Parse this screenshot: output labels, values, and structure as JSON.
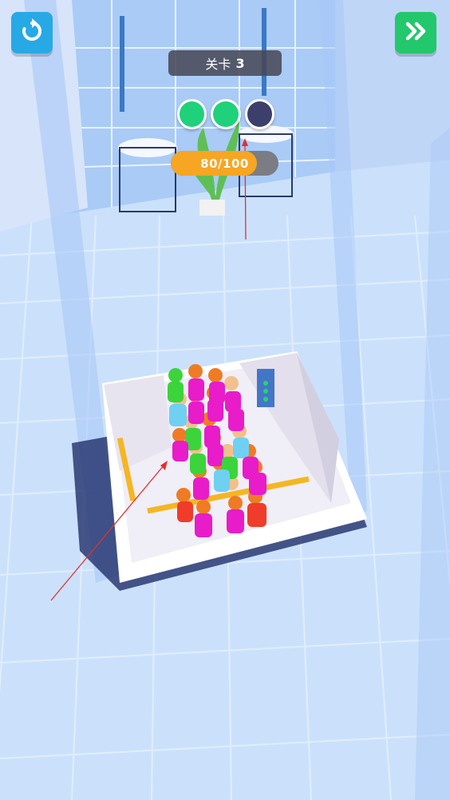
{
  "hud": {
    "restart_icon": "restart-icon",
    "skip_icon": "fast-forward-icon",
    "level_label": "关卡",
    "level_number": "3"
  },
  "stage_dots": [
    {
      "state": "complete",
      "color": "#1fd17a"
    },
    {
      "state": "complete",
      "color": "#1fd17a"
    },
    {
      "state": "current",
      "color": "#3c3f6b"
    }
  ],
  "capacity": {
    "text": "80/100",
    "current": 80,
    "max": 100
  },
  "colors": {
    "restart_button": "#27a9e6",
    "skip_button": "#22c86b",
    "progress_fill": "#f6a623",
    "progress_track": "#7c7c84"
  }
}
